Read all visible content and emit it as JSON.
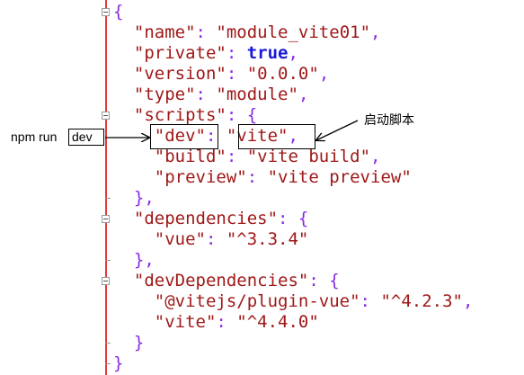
{
  "code": {
    "lines": [
      {
        "indent": 0,
        "segs": [
          {
            "t": "{",
            "c": "p"
          }
        ]
      },
      {
        "indent": 2,
        "segs": [
          {
            "t": "\"name\"",
            "c": "k"
          },
          {
            "t": ": ",
            "c": "p"
          },
          {
            "t": "\"module_vite01\"",
            "c": "s"
          },
          {
            "t": ",",
            "c": "p"
          }
        ]
      },
      {
        "indent": 2,
        "segs": [
          {
            "t": "\"private\"",
            "c": "k"
          },
          {
            "t": ": ",
            "c": "p"
          },
          {
            "t": "true",
            "c": "b"
          },
          {
            "t": ",",
            "c": "p"
          }
        ]
      },
      {
        "indent": 2,
        "segs": [
          {
            "t": "\"version\"",
            "c": "k"
          },
          {
            "t": ": ",
            "c": "p"
          },
          {
            "t": "\"0.0.0\"",
            "c": "s"
          },
          {
            "t": ",",
            "c": "p"
          }
        ]
      },
      {
        "indent": 2,
        "segs": [
          {
            "t": "\"type\"",
            "c": "k"
          },
          {
            "t": ": ",
            "c": "p"
          },
          {
            "t": "\"module\"",
            "c": "s"
          },
          {
            "t": ",",
            "c": "p"
          }
        ]
      },
      {
        "indent": 2,
        "segs": [
          {
            "t": "\"scripts\"",
            "c": "k"
          },
          {
            "t": ": {",
            "c": "p"
          }
        ]
      },
      {
        "indent": 4,
        "segs": [
          {
            "t": "\"dev\"",
            "c": "k"
          },
          {
            "t": ": ",
            "c": "p"
          },
          {
            "t": "\"vite\"",
            "c": "s"
          },
          {
            "t": ",",
            "c": "p"
          }
        ]
      },
      {
        "indent": 4,
        "segs": [
          {
            "t": "\"build\"",
            "c": "k"
          },
          {
            "t": ": ",
            "c": "p"
          },
          {
            "t": "\"vite build\"",
            "c": "s"
          },
          {
            "t": ",",
            "c": "p"
          }
        ]
      },
      {
        "indent": 4,
        "segs": [
          {
            "t": "\"preview\"",
            "c": "k"
          },
          {
            "t": ": ",
            "c": "p"
          },
          {
            "t": "\"vite preview\"",
            "c": "s"
          }
        ]
      },
      {
        "indent": 2,
        "segs": [
          {
            "t": "},",
            "c": "p"
          }
        ]
      },
      {
        "indent": 2,
        "segs": [
          {
            "t": "\"dependencies\"",
            "c": "k"
          },
          {
            "t": ": {",
            "c": "p"
          }
        ]
      },
      {
        "indent": 4,
        "segs": [
          {
            "t": "\"vue\"",
            "c": "k"
          },
          {
            "t": ": ",
            "c": "p"
          },
          {
            "t": "\"^3.3.4\"",
            "c": "s"
          }
        ]
      },
      {
        "indent": 2,
        "segs": [
          {
            "t": "},",
            "c": "p"
          }
        ]
      },
      {
        "indent": 2,
        "segs": [
          {
            "t": "\"devDependencies\"",
            "c": "k"
          },
          {
            "t": ": {",
            "c": "p"
          }
        ]
      },
      {
        "indent": 4,
        "segs": [
          {
            "t": "\"@vitejs/plugin-vue\"",
            "c": "k"
          },
          {
            "t": ": ",
            "c": "p"
          },
          {
            "t": "\"^4.2.3\"",
            "c": "s"
          },
          {
            "t": ",",
            "c": "p"
          }
        ]
      },
      {
        "indent": 4,
        "segs": [
          {
            "t": "\"vite\"",
            "c": "k"
          },
          {
            "t": ": ",
            "c": "p"
          },
          {
            "t": "\"^4.4.0\"",
            "c": "s"
          }
        ]
      },
      {
        "indent": 2,
        "segs": [
          {
            "t": "}",
            "c": "p"
          }
        ]
      },
      {
        "indent": 0,
        "segs": [
          {
            "t": "}",
            "c": "p"
          }
        ]
      }
    ]
  },
  "annotations": {
    "command_prefix": "npm run",
    "command_arg": "dev",
    "start_script_label": "启动脚本"
  },
  "colors": {
    "punctuation": "#8a2be2",
    "key": "#a01818",
    "string": "#a01818",
    "boolean": "#1a1ad6",
    "gutter_line": "#e43a3a"
  }
}
